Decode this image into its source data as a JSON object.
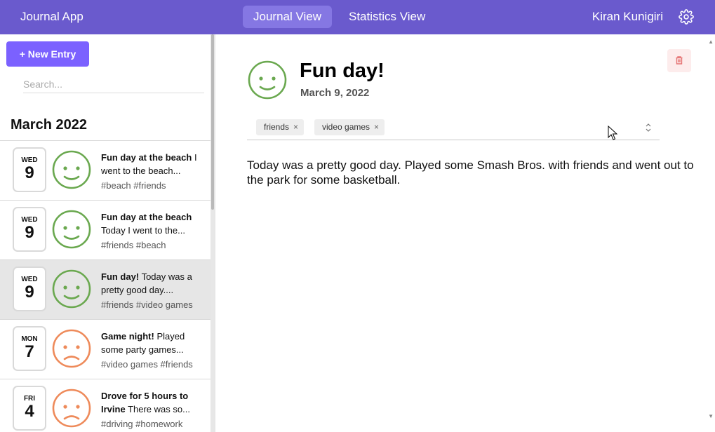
{
  "topbar": {
    "app_title": "Journal App",
    "tabs": [
      {
        "label": "Journal View",
        "active": true
      },
      {
        "label": "Statistics View",
        "active": false
      }
    ],
    "username": "Kiran Kunigiri",
    "settings_icon": "gear-icon"
  },
  "sidebar": {
    "new_entry_label": "+ New Entry",
    "search_placeholder": "Search...",
    "month_heading": "March 2022",
    "entries": [
      {
        "dow": "WED",
        "day": "9",
        "mood": "happy",
        "title": "Fun day at the beach",
        "preview": "I went to the beach...",
        "tags": "#beach #friends",
        "selected": false
      },
      {
        "dow": "WED",
        "day": "9",
        "mood": "happy",
        "title": "Fun day at the beach",
        "preview": "Today I went to the...",
        "tags": "#friends #beach",
        "selected": false
      },
      {
        "dow": "WED",
        "day": "9",
        "mood": "happy",
        "title": "Fun day!",
        "preview": "Today was a pretty good day....",
        "tags": "#friends #video games",
        "selected": true
      },
      {
        "dow": "MON",
        "day": "7",
        "mood": "sad",
        "title": "Game night!",
        "preview": "Played some party games...",
        "tags": "#video games #friends",
        "selected": false
      },
      {
        "dow": "FRI",
        "day": "4",
        "mood": "sad",
        "title": "Drove for 5 hours to Irvine",
        "preview": "There was so...",
        "tags": "#driving #homework",
        "selected": false
      }
    ]
  },
  "main": {
    "title": "Fun day!",
    "date": "March 9, 2022",
    "mood": "happy",
    "tags": [
      "friends",
      "video games"
    ],
    "tag_remove_glyph": "×",
    "body": "Today was a pretty good day. Played some Smash Bros. with friends and went out to the park for some basketball.",
    "delete_icon": "trash-icon"
  },
  "colors": {
    "topbar": "#6a5acd",
    "active_tab": "#8577e3",
    "new_entry_button": "#7b61ff",
    "happy": "#6aa84f",
    "sad": "#ee8a5a",
    "delete": "#e57373"
  }
}
